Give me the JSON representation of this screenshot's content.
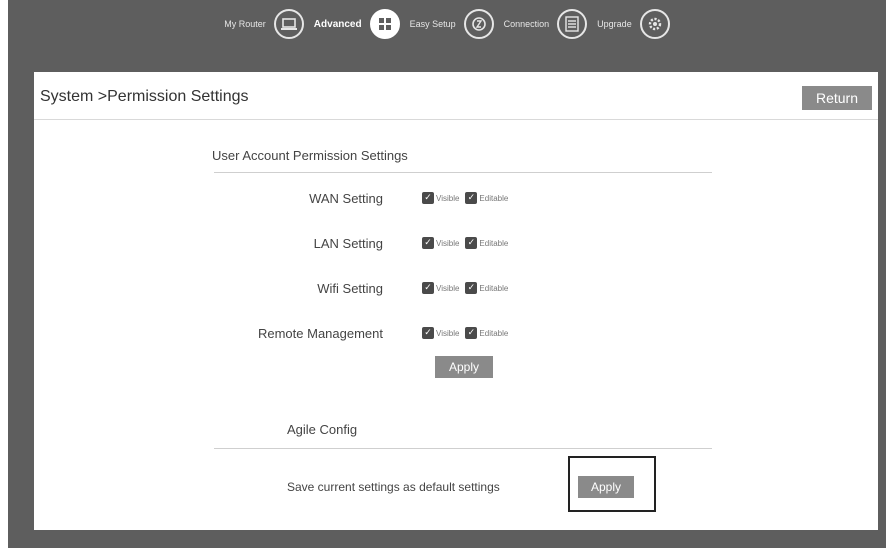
{
  "topnav": {
    "items": [
      {
        "label": "My Router",
        "icon": "laptop-icon",
        "active": false
      },
      {
        "label": "Advanced",
        "icon": "grid-icon",
        "active": true
      },
      {
        "label": "Easy Setup",
        "icon": "setup-icon",
        "active": false
      },
      {
        "label": "Connection",
        "icon": "list-icon",
        "active": false
      },
      {
        "label": "Upgrade",
        "icon": "gear-icon",
        "active": false
      }
    ]
  },
  "header": {
    "breadcrumb": "System >Permission Settings",
    "return_label": "Return"
  },
  "user_permissions": {
    "title": "User Account Permission Settings",
    "rows": [
      {
        "label": "WAN Setting",
        "visible_label": "Visible",
        "editable_label": "Editable"
      },
      {
        "label": "LAN Setting",
        "visible_label": "Visible",
        "editable_label": "Editable"
      },
      {
        "label": "Wifi Setting",
        "visible_label": "Visible",
        "editable_label": "Editable"
      },
      {
        "label": "Remote Management",
        "visible_label": "Visible",
        "editable_label": "Editable"
      }
    ],
    "apply_label": "Apply"
  },
  "agile": {
    "title": "Agile Config",
    "save_text": "Save current settings as default settings",
    "apply_label": "Apply"
  },
  "colors": {
    "background": "#5e5e5e",
    "button": "#8a8a8a",
    "checkbox": "#4a4a4a"
  }
}
